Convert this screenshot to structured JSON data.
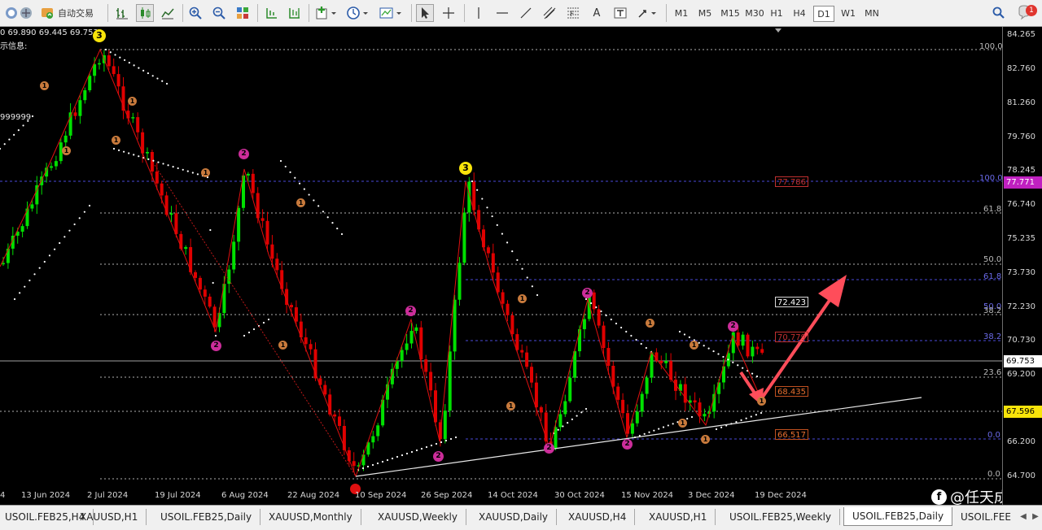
{
  "toolbar": {
    "auto_trading_label": "自动交易",
    "timeframes": [
      "M1",
      "M5",
      "M15",
      "M30",
      "H1",
      "H4",
      "D1",
      "W1",
      "MN"
    ],
    "active_timeframe": "D1",
    "text_tool_label": "A",
    "notification_count": "1"
  },
  "chart": {
    "info_line1": "0 69.890 69.445 69.753",
    "info_line2": "示信息:",
    "info_line3": "999999",
    "current_price": "69.753",
    "price_axis": [
      "84.265",
      "82.760",
      "81.260",
      "79.760",
      "78.245",
      "76.740",
      "75.235",
      "73.730",
      "72.230",
      "70.730",
      "69.200",
      "66.200",
      "64.700"
    ],
    "highlighted_prices": {
      "upper": "77.771",
      "current": "69.753",
      "lower": "67.596"
    },
    "dates": [
      "4",
      "13 Jun 2024",
      "2 Jul 2024",
      "19 Jul 2024",
      "6 Aug 2024",
      "22 Aug 2024",
      "10 Sep 2024",
      "26 Sep 2024",
      "14 Oct 2024",
      "30 Oct 2024",
      "15 Nov 2024",
      "3 Dec 2024",
      "19 Dec 2024"
    ],
    "fib_levels": [
      "100.0",
      "100.0",
      "61.8",
      "50.0",
      "61.8",
      "50.0",
      "38.2",
      "38.2",
      "23.6",
      "0.0",
      "0.0"
    ],
    "boxed_values": [
      "77.786",
      "72.423",
      "70.779",
      "68.435",
      "66.517"
    ],
    "wave_marker_labels": [
      "1",
      "2",
      "3"
    ]
  },
  "tabs": [
    "USOIL.FEB25,H4",
    "XAUUSD,H1",
    "USOIL.FEB25,Daily",
    "XAUUSD,Monthly",
    "XAUUSD,Weekly",
    "XAUUSD,Daily",
    "XAUUSD,H4",
    "XAUUSD,H1",
    "USOIL.FEB25,Weekly",
    "USOIL.FEB25,Daily",
    "USOIL.FEE"
  ],
  "active_tab": "USOIL.FEB25,Daily",
  "watermark": "@任天成",
  "colors": {
    "bull": "#00e000",
    "bear": "#e00000",
    "background": "#000000",
    "fib_blue": "#4a4ad8",
    "arrow": "#ff4d5a"
  }
}
